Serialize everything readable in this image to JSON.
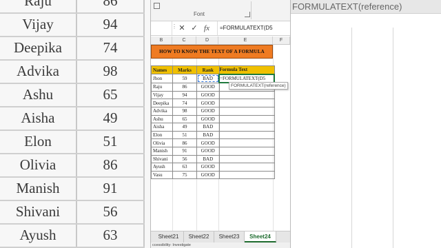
{
  "background": {
    "names": [
      "Raju",
      "Vijay",
      "Deepika",
      "Advika",
      "Ashu",
      "Aisha",
      "Elon",
      "Olivia",
      "Manish",
      "Shivani",
      "Ayush"
    ],
    "marks": [
      "86",
      "94",
      "74",
      "98",
      "65",
      "49",
      "51",
      "86",
      "91",
      "56",
      "63"
    ],
    "topbar_text": "FORMULATEXT(reference)"
  },
  "ribbon": {
    "group_label": "Font"
  },
  "formula_bar": {
    "cancel_icon": "✕",
    "enter_icon": "✓",
    "fx_label": "fx",
    "content": "=FORMULATEXT(D5"
  },
  "columns": [
    "B",
    "C",
    "D",
    "E",
    "F"
  ],
  "title": "HOW TO KNOW THE TEXT OF A FORMULA",
  "table": {
    "headers": [
      "Names",
      "Marks",
      "Rank",
      "Formula Text"
    ],
    "rows": [
      {
        "name": "Jhon",
        "marks": "59",
        "rank": "BAD",
        "formula": "=FORMULATEXT(D5"
      },
      {
        "name": "Raju",
        "marks": "86",
        "rank": "GOOD",
        "formula": ""
      },
      {
        "name": "Vijay",
        "marks": "94",
        "rank": "GOOD",
        "formula": ""
      },
      {
        "name": "Deepika",
        "marks": "74",
        "rank": "GOOD",
        "formula": ""
      },
      {
        "name": "Advika",
        "marks": "98",
        "rank": "GOOD",
        "formula": ""
      },
      {
        "name": "Ashu",
        "marks": "65",
        "rank": "GOOD",
        "formula": ""
      },
      {
        "name": "Aisha",
        "marks": "49",
        "rank": "BAD",
        "formula": ""
      },
      {
        "name": "Elon",
        "marks": "51",
        "rank": "BAD",
        "formula": ""
      },
      {
        "name": "Olivia",
        "marks": "86",
        "rank": "GOOD",
        "formula": ""
      },
      {
        "name": "Manish",
        "marks": "91",
        "rank": "GOOD",
        "formula": ""
      },
      {
        "name": "Shivani",
        "marks": "56",
        "rank": "BAD",
        "formula": ""
      },
      {
        "name": "Ayush",
        "marks": "63",
        "rank": "GOOD",
        "formula": ""
      },
      {
        "name": "Vasu",
        "marks": "75",
        "rank": "GOOD",
        "formula": ""
      }
    ]
  },
  "tooltip": "FORMULATEXT(reference)",
  "sheet_tabs": [
    "Sheet21",
    "Sheet22",
    "Sheet23",
    "Sheet24"
  ],
  "active_tab": "Sheet24",
  "status_text": "ccessibility: Investigate",
  "colors": {
    "title_bg": "#ef7b22",
    "header_bg": "#f0c000",
    "active_tab": "#1d6b2e"
  }
}
